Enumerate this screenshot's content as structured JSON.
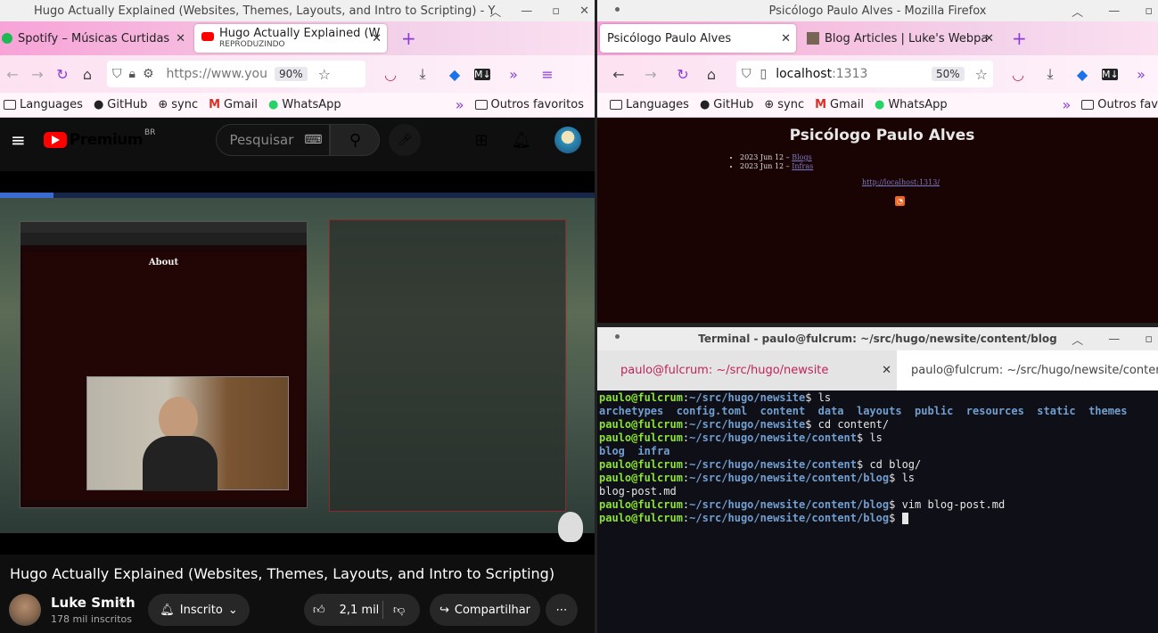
{
  "left_window": {
    "title": "Hugo Actually Explained (Websites, Themes, Layouts, and Intro to Scripting) - Y",
    "tabs": [
      {
        "label": "Spotify – Músicas Curtidas"
      },
      {
        "label": "Hugo Actually Explained (W",
        "sub": "REPRODUZINDO"
      }
    ],
    "url": "https://www.you",
    "zoom": "90%",
    "bookmarks": [
      "Languages",
      "GitHub",
      "sync",
      "Gmail",
      "WhatsApp"
    ],
    "other_bookmarks": "Outros favoritos"
  },
  "youtube": {
    "logo": "Premium",
    "region": "BR",
    "search_placeholder": "Pesquisar",
    "video_title": "Hugo Actually Explained (Websites, Themes, Layouts, and Intro to Scripting)",
    "channel": "Luke Smith",
    "subscribers": "178 mil inscritos",
    "subscribed_label": "Inscrito",
    "likes": "2,1 mil",
    "share_label": "Compartilhar",
    "inner_about_title": "About"
  },
  "right_window": {
    "title": "Psicólogo Paulo Alves - Mozilla Firefox",
    "tabs": [
      {
        "label": "Psicólogo Paulo Alves"
      },
      {
        "label": "Blog Articles | Luke's Webpa"
      }
    ],
    "url_host": "localhost",
    "url_port": ":1313",
    "zoom": "50%",
    "bookmarks": [
      "Languages",
      "GitHub",
      "sync",
      "Gmail",
      "WhatsApp"
    ],
    "other_bookmarks": "Outros fav"
  },
  "site": {
    "heading": "Psicólogo Paulo Alves",
    "items": [
      {
        "date": "2023 Jun 12 – ",
        "link": "Blogs"
      },
      {
        "date": "2023 Jun 12 – ",
        "link": "Infras"
      }
    ],
    "footer_link": "http://localhost:1313/"
  },
  "terminal": {
    "title": "Terminal - paulo@fulcrum: ~/src/hugo/newsite/content/blog",
    "tabs": [
      {
        "label": "paulo@fulcrum: ~/src/hugo/newsite"
      },
      {
        "label": "paulo@fulcrum: ~/src/hugo/newsite/content..."
      }
    ],
    "lines": [
      {
        "user": "paulo@fulcrum",
        "path": "~/src/hugo/newsite",
        "cmd": "$ ls"
      },
      {
        "out": "archetypes  config.toml  content  data  layouts  public  resources  static  themes"
      },
      {
        "user": "paulo@fulcrum",
        "path": "~/src/hugo/newsite",
        "cmd": "$ cd content/"
      },
      {
        "user": "paulo@fulcrum",
        "path": "~/src/hugo/newsite/content",
        "cmd": "$ ls"
      },
      {
        "out": "blog  infra"
      },
      {
        "user": "paulo@fulcrum",
        "path": "~/src/hugo/newsite/content",
        "cmd": "$ cd blog/"
      },
      {
        "user": "paulo@fulcrum",
        "path": "~/src/hugo/newsite/content/blog",
        "cmd": "$ ls"
      },
      {
        "out": "blog-post.md"
      },
      {
        "user": "paulo@fulcrum",
        "path": "~/src/hugo/newsite/content/blog",
        "cmd": "$ vim blog-post.md"
      },
      {
        "user": "paulo@fulcrum",
        "path": "~/src/hugo/newsite/content/blog",
        "cmd": "$ "
      }
    ]
  }
}
